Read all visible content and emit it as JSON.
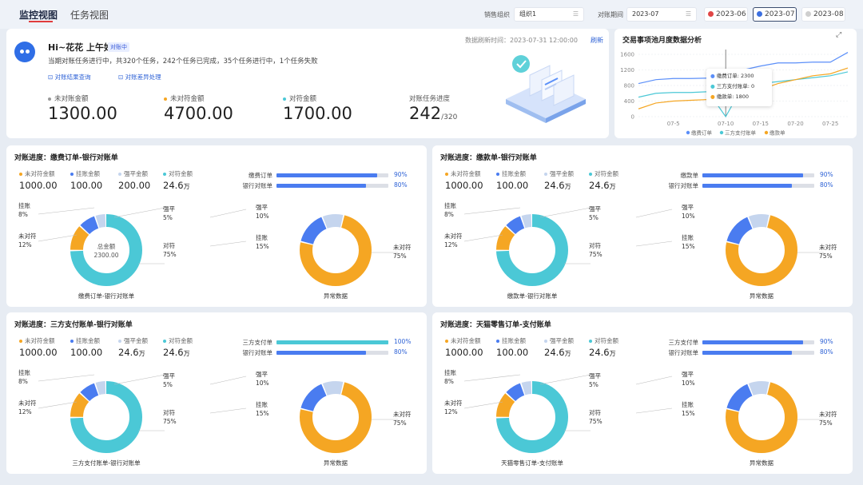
{
  "nav": {
    "tabs": [
      {
        "label": "监控视图"
      },
      {
        "label": "任务视图"
      }
    ]
  },
  "filters": {
    "org_label": "销售组织",
    "org_value": "组织1",
    "period_label": "对账期间",
    "period_value": "2023-07",
    "periods": [
      {
        "label": "2023-06",
        "color": "#e04545"
      },
      {
        "label": "2023-07",
        "color": "#3b6fe0"
      },
      {
        "label": "2023-08",
        "color": "#cfcfcf"
      }
    ]
  },
  "header": {
    "greeting": "Hi~花花 上午好",
    "badge": "对账中",
    "summary": "当期对账任务进行中，共320个任务，242个任务已完成，35个任务进行中，1个任务失败",
    "link_result": "对账结果查询",
    "link_diff": "对账差异处理",
    "refresh_text": "数据刷新时间：2023-07-31 12:00:00",
    "refresh_link": "刷新",
    "stats": [
      {
        "label": "未对账金额",
        "value": "1300.00",
        "color": "#999999"
      },
      {
        "label": "未对符金额",
        "value": "4700.00",
        "color": "#f5a623"
      },
      {
        "label": "对符金额",
        "value": "1700.00",
        "color": "#4bc8d6"
      }
    ],
    "progress": {
      "label": "对账任务进度",
      "value": "242",
      "total": "/320"
    }
  },
  "trend": {
    "title": "交易事项池月度数据分析",
    "tooltip": [
      {
        "name": "缴费订单",
        "value": "2300",
        "color": "#5b8ff9"
      },
      {
        "name": "三方支付账单",
        "value": "0",
        "color": "#4bc8d6"
      },
      {
        "name": "缴款单",
        "value": "1800",
        "color": "#f5a623"
      }
    ]
  },
  "chart_data": {
    "type": "line",
    "x": [
      "07-1",
      "07-3",
      "07-5",
      "07-7",
      "07-9",
      "07-10",
      "07-12",
      "07-15",
      "07-18",
      "07-20",
      "07-23",
      "07-25",
      "07-28"
    ],
    "x_tick_labels": [
      "07-5",
      "07-10",
      "07-15",
      "07-20",
      "07-25"
    ],
    "ylim": [
      0,
      1600
    ],
    "y_ticks": [
      0,
      400,
      800,
      1200,
      1600
    ],
    "grid": true,
    "legend": "bottom",
    "series": [
      {
        "name": "缴费订单",
        "color": "#5b8ff9",
        "values": [
          850,
          950,
          980,
          980,
          990,
          990,
          1200,
          1300,
          1380,
          1380,
          1400,
          1400,
          1650
        ]
      },
      {
        "name": "三方支付账单",
        "color": "#4bc8d6",
        "values": [
          500,
          600,
          620,
          620,
          640,
          0,
          800,
          850,
          900,
          950,
          1000,
          1050,
          1150
        ]
      },
      {
        "name": "缴款单",
        "color": "#f5a623",
        "values": [
          200,
          350,
          400,
          420,
          440,
          450,
          500,
          700,
          850,
          950,
          1050,
          1100,
          1250
        ]
      }
    ]
  },
  "panels": [
    {
      "title": "对账进度：缴费订单-银行对账单",
      "metrics": [
        {
          "label": "未对符金额",
          "value": "1000.00",
          "unit": "",
          "color": "#f5a623"
        },
        {
          "label": "挂账金额",
          "value": "100.00",
          "unit": "",
          "color": "#4a7cf0"
        },
        {
          "label": "强平金额",
          "value": "200.00",
          "unit": "",
          "color": "#c5d5ee"
        },
        {
          "label": "对符金额",
          "value": "24.6",
          "unit": "万",
          "color": "#4bc8d6"
        }
      ],
      "bars": [
        {
          "label": "缴费订单",
          "percent": 90,
          "percent_label": "90%",
          "color": "#4a7cf0"
        },
        {
          "label": "银行对账单",
          "percent": 80,
          "percent_label": "80%",
          "color": "#4a7cf0"
        }
      ],
      "pie1": {
        "caption": "缴费订单-银行对账单",
        "center_label": "总金额",
        "center_value": "2300.00",
        "slices": [
          {
            "name": "对符",
            "percent": 75,
            "label": "75%",
            "color": "#4bc8d6"
          },
          {
            "name": "未对符",
            "percent": 12,
            "label": "12%",
            "color": "#f5a623"
          },
          {
            "name": "挂账",
            "percent": 8,
            "label": "8%",
            "color": "#4a7cf0"
          },
          {
            "name": "强平",
            "percent": 5,
            "label": "5%",
            "color": "#c5d5ee"
          }
        ]
      },
      "pie2": {
        "caption": "异常数据",
        "slices": [
          {
            "name": "未对符",
            "percent": 75,
            "label": "75%",
            "color": "#f5a623"
          },
          {
            "name": "挂账",
            "percent": 15,
            "label": "15%",
            "color": "#4a7cf0"
          },
          {
            "name": "强平",
            "percent": 10,
            "label": "10%",
            "color": "#c5d5ee"
          }
        ]
      }
    },
    {
      "title": "对账进度：缴款单-银行对账单",
      "metrics": [
        {
          "label": "未对符金额",
          "value": "1000.00",
          "unit": "",
          "color": "#f5a623"
        },
        {
          "label": "挂账金额",
          "value": "100.00",
          "unit": "",
          "color": "#4a7cf0"
        },
        {
          "label": "强平金额",
          "value": "24.6",
          "unit": "万",
          "color": "#c5d5ee"
        },
        {
          "label": "对符金额",
          "value": "24.6",
          "unit": "万",
          "color": "#4bc8d6"
        }
      ],
      "bars": [
        {
          "label": "缴款单",
          "percent": 90,
          "percent_label": "90%",
          "color": "#4a7cf0"
        },
        {
          "label": "银行对账单",
          "percent": 80,
          "percent_label": "80%",
          "color": "#4a7cf0"
        }
      ],
      "pie1": {
        "caption": "缴款单-银行对账单",
        "center_label": "",
        "center_value": "",
        "slices": [
          {
            "name": "对符",
            "percent": 75,
            "label": "75%",
            "color": "#4bc8d6"
          },
          {
            "name": "未对符",
            "percent": 12,
            "label": "12%",
            "color": "#f5a623"
          },
          {
            "name": "挂账",
            "percent": 8,
            "label": "8%",
            "color": "#4a7cf0"
          },
          {
            "name": "强平",
            "percent": 5,
            "label": "5%",
            "color": "#c5d5ee"
          }
        ]
      },
      "pie2": {
        "caption": "异常数据",
        "slices": [
          {
            "name": "未对符",
            "percent": 75,
            "label": "75%",
            "color": "#f5a623"
          },
          {
            "name": "挂账",
            "percent": 15,
            "label": "15%",
            "color": "#4a7cf0"
          },
          {
            "name": "强平",
            "percent": 10,
            "label": "10%",
            "color": "#c5d5ee"
          }
        ]
      }
    },
    {
      "title": "对账进度：三方支付账单-银行对账单",
      "metrics": [
        {
          "label": "未对符金额",
          "value": "1000.00",
          "unit": "",
          "color": "#f5a623"
        },
        {
          "label": "挂账金额",
          "value": "100.00",
          "unit": "",
          "color": "#4a7cf0"
        },
        {
          "label": "强平金额",
          "value": "24.6",
          "unit": "万",
          "color": "#c5d5ee"
        },
        {
          "label": "对符金额",
          "value": "24.6",
          "unit": "万",
          "color": "#4bc8d6"
        }
      ],
      "bars": [
        {
          "label": "三方支付单",
          "percent": 100,
          "percent_label": "100%",
          "color": "#4bc8d6"
        },
        {
          "label": "银行对账单",
          "percent": 80,
          "percent_label": "80%",
          "color": "#4a7cf0"
        }
      ],
      "pie1": {
        "caption": "三方支付账单-银行对账单",
        "center_label": "",
        "center_value": "",
        "slices": [
          {
            "name": "对符",
            "percent": 75,
            "label": "75%",
            "color": "#4bc8d6"
          },
          {
            "name": "未对符",
            "percent": 12,
            "label": "12%",
            "color": "#f5a623"
          },
          {
            "name": "挂账",
            "percent": 8,
            "label": "8%",
            "color": "#4a7cf0"
          },
          {
            "name": "强平",
            "percent": 5,
            "label": "5%",
            "color": "#c5d5ee"
          }
        ]
      },
      "pie2": {
        "caption": "异常数据",
        "slices": [
          {
            "name": "未对符",
            "percent": 75,
            "label": "75%",
            "color": "#f5a623"
          },
          {
            "name": "挂账",
            "percent": 15,
            "label": "15%",
            "color": "#4a7cf0"
          },
          {
            "name": "强平",
            "percent": 10,
            "label": "10%",
            "color": "#c5d5ee"
          }
        ]
      }
    },
    {
      "title": "对账进度：天猫零售订单-支付账单",
      "metrics": [
        {
          "label": "未对符金额",
          "value": "1000.00",
          "unit": "",
          "color": "#f5a623"
        },
        {
          "label": "挂账金额",
          "value": "100.00",
          "unit": "",
          "color": "#4a7cf0"
        },
        {
          "label": "强平金额",
          "value": "24.6",
          "unit": "万",
          "color": "#c5d5ee"
        },
        {
          "label": "对符金额",
          "value": "24.6",
          "unit": "万",
          "color": "#4bc8d6"
        }
      ],
      "bars": [
        {
          "label": "三方支付单",
          "percent": 90,
          "percent_label": "90%",
          "color": "#4a7cf0"
        },
        {
          "label": "银行对账单",
          "percent": 80,
          "percent_label": "80%",
          "color": "#4a7cf0"
        }
      ],
      "pie1": {
        "caption": "天猫零售订单-支付账单",
        "center_label": "",
        "center_value": "",
        "slices": [
          {
            "name": "对符",
            "percent": 75,
            "label": "75%",
            "color": "#4bc8d6"
          },
          {
            "name": "未对符",
            "percent": 12,
            "label": "12%",
            "color": "#f5a623"
          },
          {
            "name": "挂账",
            "percent": 8,
            "label": "8%",
            "color": "#4a7cf0"
          },
          {
            "name": "强平",
            "percent": 5,
            "label": "5%",
            "color": "#c5d5ee"
          }
        ]
      },
      "pie2": {
        "caption": "异常数据",
        "slices": [
          {
            "name": "未对符",
            "percent": 75,
            "label": "75%",
            "color": "#f5a623"
          },
          {
            "name": "挂账",
            "percent": 15,
            "label": "15%",
            "color": "#4a7cf0"
          },
          {
            "name": "强平",
            "percent": 10,
            "label": "10%",
            "color": "#c5d5ee"
          }
        ]
      }
    }
  ]
}
